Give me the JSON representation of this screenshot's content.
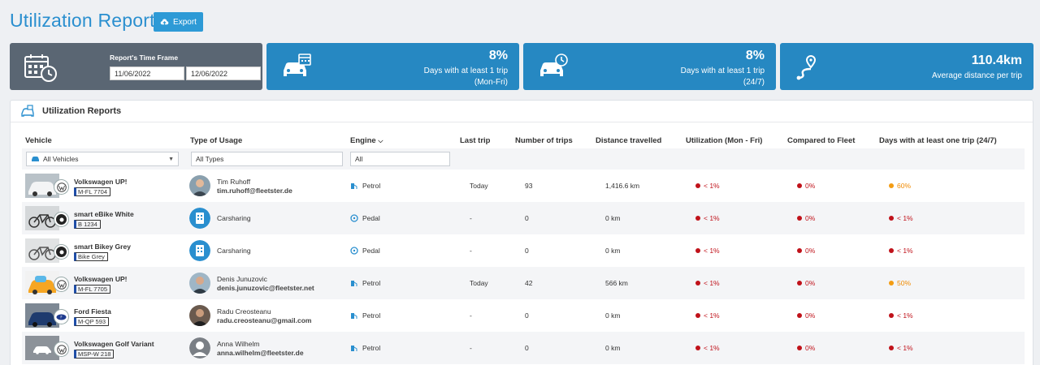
{
  "header": {
    "title": "Utilization Reports",
    "export_label": "Export"
  },
  "time_frame": {
    "label": "Report's Time Frame",
    "from": "11/06/2022",
    "to": "12/06/2022"
  },
  "kpis": [
    {
      "value": "8%",
      "caption_line1": "Days with at least 1 trip",
      "caption_line2": "(Mon-Fri)"
    },
    {
      "value": "8%",
      "caption_line1": "Days with at least 1 trip",
      "caption_line2": "(24/7)"
    },
    {
      "value": "110.4km",
      "caption_line1": "Average distance per trip",
      "caption_line2": ""
    }
  ],
  "panel": {
    "title": "Utilization Reports",
    "columns": {
      "vehicle": "Vehicle",
      "usage": "Type of Usage",
      "engine": "Engine",
      "last_trip": "Last trip",
      "trips": "Number of trips",
      "distance": "Distance travelled",
      "util": "Utilization (Mon - Fri)",
      "compared": "Compared to Fleet",
      "days": "Days with at least one trip (24/7)"
    },
    "filters": {
      "vehicle": "All Vehicles",
      "usage": "All Types",
      "engine": "All"
    }
  },
  "rows": [
    {
      "vehicle": "Volkswagen UP!",
      "plate": "M-FL 7704",
      "user_name": "Tim Ruhoff",
      "user_email": "tim.ruhoff@fleetster.de",
      "engine": "Petrol",
      "last_trip": "Today",
      "trips": "93",
      "distance": "1,416.6 km",
      "util": "< 1%",
      "compared": "0%",
      "days": "60%"
    },
    {
      "vehicle": "smart eBike White",
      "plate": "B 1234",
      "usage": "Carsharing",
      "engine": "Pedal",
      "last_trip": "-",
      "trips": "0",
      "distance": "0 km",
      "util": "< 1%",
      "compared": "0%",
      "days": "< 1%"
    },
    {
      "vehicle": "smart Bikey Grey",
      "plate": "Bike Grey",
      "usage": "Carsharing",
      "engine": "Pedal",
      "last_trip": "-",
      "trips": "0",
      "distance": "0 km",
      "util": "< 1%",
      "compared": "0%",
      "days": "< 1%"
    },
    {
      "vehicle": "Volkswagen UP!",
      "plate": "M-FL 7705",
      "user_name": "Denis Junuzovic",
      "user_email": "denis.junuzovic@fleetster.net",
      "engine": "Petrol",
      "last_trip": "Today",
      "trips": "42",
      "distance": "566 km",
      "util": "< 1%",
      "compared": "0%",
      "days": "50%"
    },
    {
      "vehicle": "Ford Fiesta",
      "plate": "M-QP 593",
      "user_name": "Radu Creosteanu",
      "user_email": "radu.creosteanu@gmail.com",
      "engine": "Petrol",
      "last_trip": "-",
      "trips": "0",
      "distance": "0 km",
      "util": "< 1%",
      "compared": "0%",
      "days": "< 1%"
    },
    {
      "vehicle": "Volkswagen Golf Variant",
      "plate": "MSP-W 218",
      "user_name": "Anna Wilhelm",
      "user_email": "anna.wilhelm@fleetster.de",
      "engine": "Petrol",
      "last_trip": "-",
      "trips": "0",
      "distance": "0 km",
      "util": "< 1%",
      "compared": "0%",
      "days": "< 1%"
    }
  ],
  "colors": {
    "accent": "#2d9ad6",
    "kpi_blue": "#2688c2",
    "kpi_grey": "#5a6673",
    "status_red": "#c0121a",
    "status_orange": "#f39c12"
  }
}
